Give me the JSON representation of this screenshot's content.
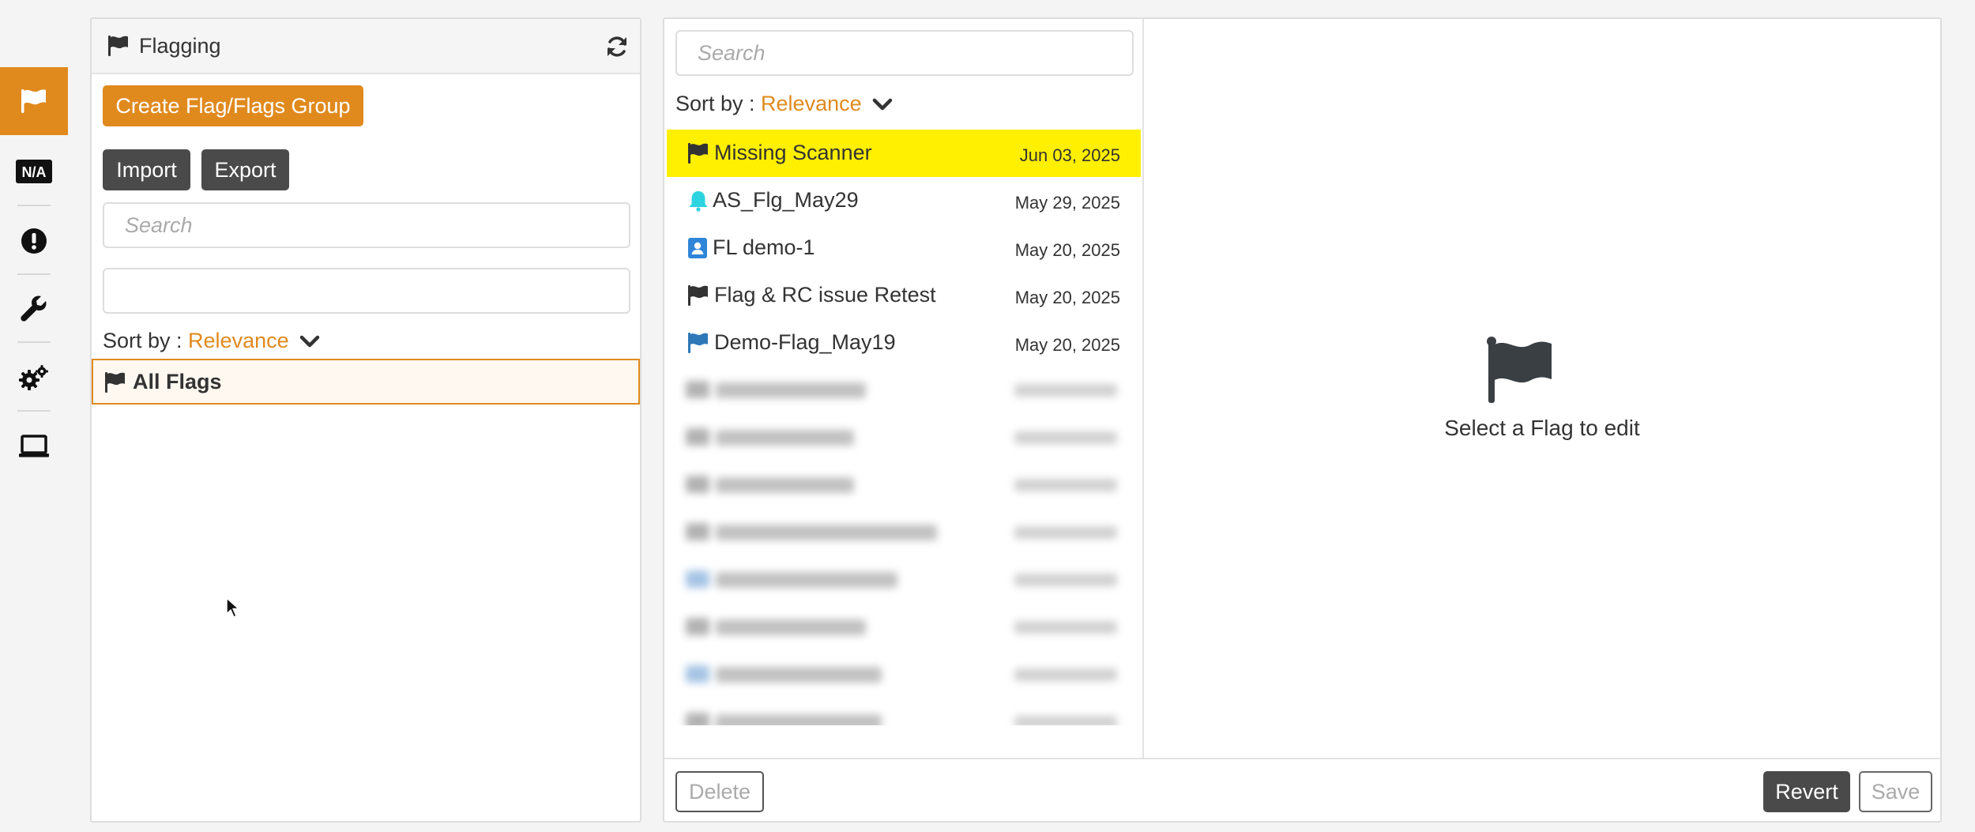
{
  "sidebar": {
    "items": [
      {
        "icon": "flag-icon",
        "active": true
      },
      {
        "icon": "na-icon",
        "label": "N/A"
      },
      {
        "icon": "alert-circle-icon"
      },
      {
        "icon": "wrench-icon"
      },
      {
        "icon": "gears-icon"
      },
      {
        "icon": "laptop-icon"
      }
    ]
  },
  "left": {
    "title": "Flagging",
    "create_label": "Create Flag/Flags Group",
    "import_label": "Import",
    "export_label": "Export",
    "search_placeholder": "Search",
    "filter_value": "",
    "sort_label": "Sort by : ",
    "sort_value": "Relevance",
    "tree_root_label": "All Flags"
  },
  "right": {
    "search_placeholder": "Search",
    "sort_label": "Sort by : ",
    "sort_value": "Relevance",
    "items": [
      {
        "name": "Missing Scanner",
        "date": "Jun 03, 2025",
        "icon": "flag-icon",
        "color": "#333333",
        "selected": true
      },
      {
        "name": "AS_Flg_May29",
        "date": "May 29, 2025",
        "icon": "bell-icon",
        "color": "#2ed3e0"
      },
      {
        "name": "FL demo-1",
        "date": "May 20, 2025",
        "icon": "contact-card-icon",
        "color": "#2f86d8"
      },
      {
        "name": "Flag & RC issue Retest",
        "date": "May 20, 2025",
        "icon": "flag-icon",
        "color": "#333333"
      },
      {
        "name": "Demo-Flag_May19",
        "date": "May 20, 2025",
        "icon": "flag-icon",
        "color": "#2f78b8"
      }
    ],
    "placeholder_text": "Select a Flag to edit",
    "delete_label": "Delete",
    "revert_label": "Revert",
    "save_label": "Save"
  },
  "colors": {
    "accent": "#e08a1e",
    "selected_row": "#ffef00",
    "dark_button": "#4a4a4a"
  }
}
